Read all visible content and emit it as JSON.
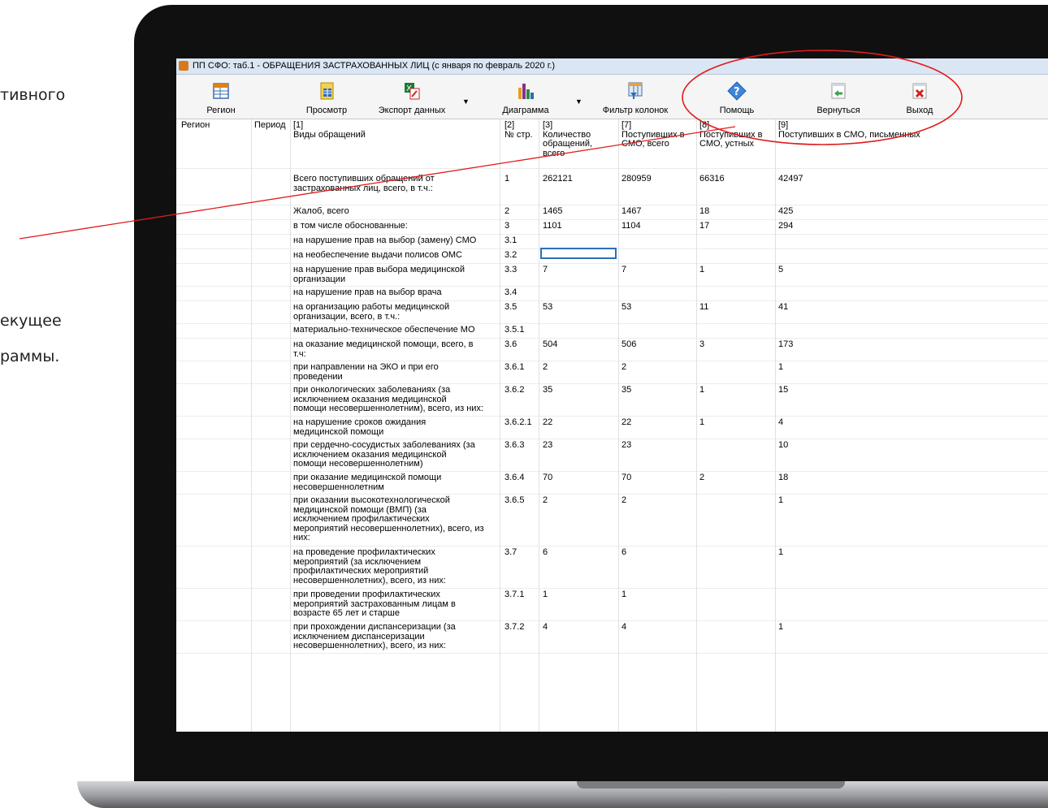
{
  "slide": {
    "text_fragments": [
      "тивного",
      "екущее",
      "раммы."
    ]
  },
  "window": {
    "title": "ПП СФО: таб.1 - ОБРАЩЕНИЯ ЗАСТРАХОВАННЫХ ЛИЦ (с января по февраль 2020 г.)"
  },
  "toolbar": {
    "region": "Регион",
    "view": "Просмотр",
    "export": "Экспорт данных",
    "chart": "Диаграмма",
    "filter": "Фильтр колонок",
    "help": "Помощь",
    "back": "Вернуться",
    "exit": "Выход",
    "dropdown_glyph": "▼"
  },
  "table": {
    "headers": {
      "region": "Регион",
      "period": "Период",
      "c1": "[1]\nВиды обращений",
      "c2": "[2]\n№ стр.",
      "c3": "[3]\nКоличество\nобращений,\nвсего",
      "c7": "[7]\nПоступивших в\nСМО, всего",
      "c8": "[8]\nПоступивших в\nСМО, устных",
      "c9": "[9]\nПоступивших в СМО, письменных"
    },
    "rows": [
      {
        "name": "Всего поступивших обращений от\nзастрахованных лиц, всего, в т.ч.:",
        "num": "1",
        "c3": "262121",
        "c7": "280959",
        "c8": "66316",
        "c9": "42497"
      },
      {
        "name": "Жалоб, всего",
        "num": "2",
        "c3": "1465",
        "c7": "1467",
        "c8": "18",
        "c9": "425"
      },
      {
        "name": "в том числе обоснованные:",
        "num": "3",
        "c3": "1101",
        "c7": "1104",
        "c8": "17",
        "c9": "294"
      },
      {
        "name": "на нарушение прав на выбор (замену) СМО",
        "num": "3.1",
        "c3": "",
        "c7": "",
        "c8": "",
        "c9": ""
      },
      {
        "name": "на необеспечение выдачи полисов ОМС",
        "num": "3.2",
        "c3": "",
        "c7": "",
        "c8": "",
        "c9": ""
      },
      {
        "name": "на нарушение прав выбора медицинской\nорганизации",
        "num": "3.3",
        "c3": "7",
        "c7": "7",
        "c8": "1",
        "c9": "5"
      },
      {
        "name": "на нарушение прав на выбор врача",
        "num": "3.4",
        "c3": "",
        "c7": "",
        "c8": "",
        "c9": ""
      },
      {
        "name": "на организацию работы медицинской\nорганизации, всего, в т.ч.:",
        "num": "3.5",
        "c3": "53",
        "c7": "53",
        "c8": "11",
        "c9": "41"
      },
      {
        "name": "материально-техническое обеспечение МО",
        "num": "3.5.1",
        "c3": "",
        "c7": "",
        "c8": "",
        "c9": ""
      },
      {
        "name": "на оказание медицинской помощи, всего, в\nт.ч:",
        "num": "3.6",
        "c3": "504",
        "c7": "506",
        "c8": "3",
        "c9": "173"
      },
      {
        "name": "при направлении на ЭКО и при его\nпроведении",
        "num": "3.6.1",
        "c3": "2",
        "c7": "2",
        "c8": "",
        "c9": "1"
      },
      {
        "name": "при онкологических заболеваниях (за\nисключением оказания медицинской\nпомощи несовершеннолетним), всего, из них:",
        "num": "3.6.2",
        "c3": "35",
        "c7": "35",
        "c8": "1",
        "c9": "15"
      },
      {
        "name": "на нарушение сроков ожидания\nмедицинской помощи",
        "num": "3.6.2.1",
        "c3": "22",
        "c7": "22",
        "c8": "1",
        "c9": "4"
      },
      {
        "name": "при сердечно-сосудистых заболеваниях (за\nисключением оказания медицинской\nпомощи несовершеннолетним)",
        "num": "3.6.3",
        "c3": "23",
        "c7": "23",
        "c8": "",
        "c9": "10"
      },
      {
        "name": "при оказание медицинской помощи\nнесовершеннолетним",
        "num": "3.6.4",
        "c3": "70",
        "c7": "70",
        "c8": "2",
        "c9": "18"
      },
      {
        "name": "при оказании высокотехнологической\nмедицинской помощи (ВМП) (за\nисключением профилактических\nмероприятий несовершеннолетних), всего, из\nних:",
        "num": "3.6.5",
        "c3": "2",
        "c7": "2",
        "c8": "",
        "c9": "1"
      },
      {
        "name": "на проведение профилактических\nмероприятий (за исключением\nпрофилактических мероприятий\nнесовершеннолетних), всего, из них:",
        "num": "3.7",
        "c3": "6",
        "c7": "6",
        "c8": "",
        "c9": "1"
      },
      {
        "name": "при проведении профилактических\nмероприятий застрахованным лицам в\nвозрасте 65 лет и старше",
        "num": "3.7.1",
        "c3": "1",
        "c7": "1",
        "c8": "",
        "c9": ""
      },
      {
        "name": "при прохождении диспансеризации (за\nисключением диспансеризации\nнесовершеннолетних), всего, из них:",
        "num": "3.7.2",
        "c3": "4",
        "c7": "4",
        "c8": "",
        "c9": "1"
      }
    ]
  },
  "colors": {
    "annotation": "#e21b1b",
    "selection": "#2d6fb8",
    "titlebar": "#dbe6f4"
  }
}
